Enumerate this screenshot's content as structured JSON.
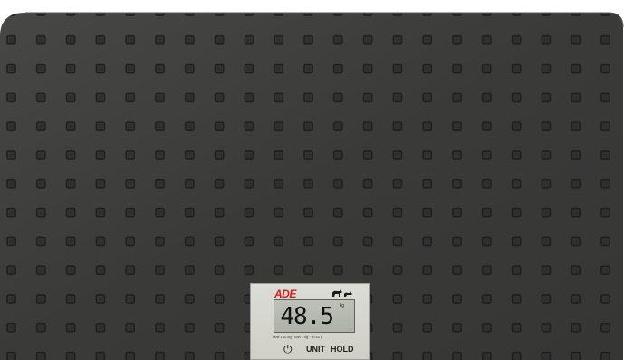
{
  "device": {
    "brand": "ADE",
    "reading": "48.5",
    "unit": "kg",
    "specs": "Max 150 kg · Min 2 kg · d=50 g",
    "buttons": {
      "power_label": "⏻",
      "unit_label": "UNIT",
      "hold_label": "HOLD"
    }
  },
  "icons": {
    "animals": "dog-and-cat-icon",
    "power": "power-icon"
  },
  "colors": {
    "scale_surface": "#3a3a39",
    "brand_red": "#d41d1d",
    "lcd_background": "#b8bbb2",
    "panel_background": "#d6d6cf"
  }
}
